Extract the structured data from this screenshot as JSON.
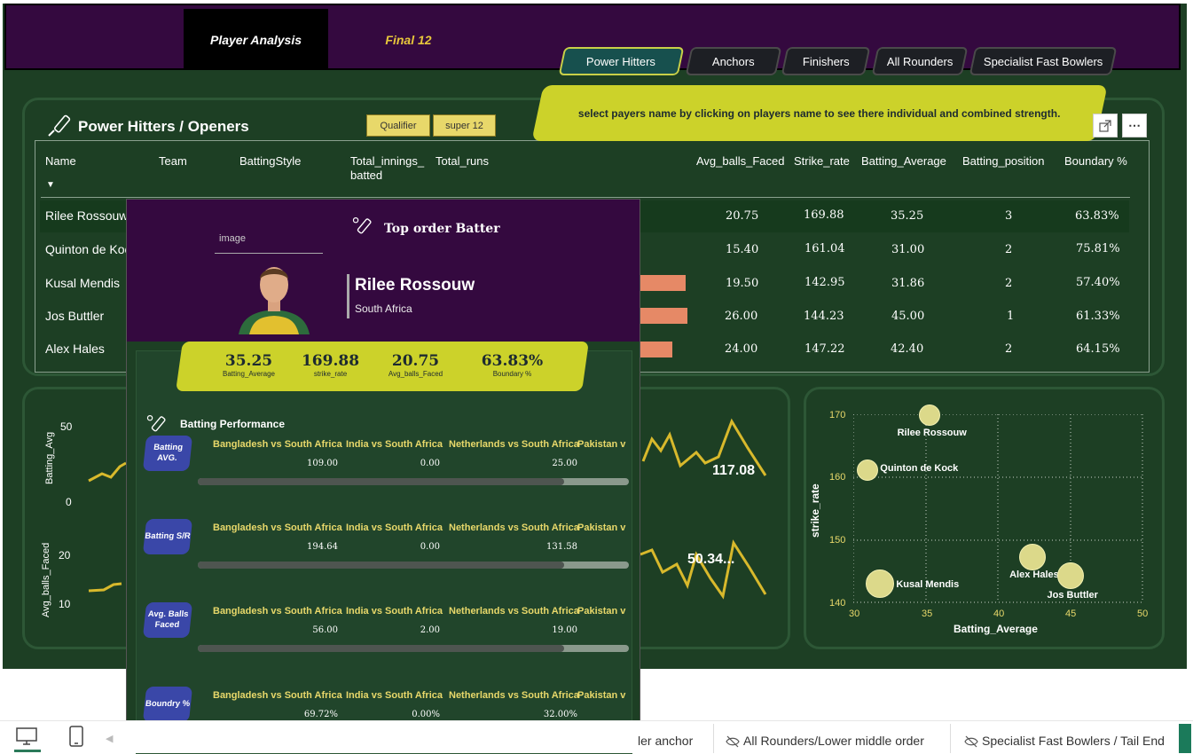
{
  "nav": {
    "active_tab": "Player Analysis",
    "other_tab": "Final 12"
  },
  "segments": [
    "Power Hitters",
    "Anchors",
    "Finishers",
    "All Rounders",
    "Specialist Fast Bowlers"
  ],
  "banner_text": "select payers name by clicking on players name to see there individual and combined strength.",
  "table": {
    "title": "Power Hitters / Openers",
    "chips": [
      "Qualifier",
      "super 12"
    ],
    "headers": {
      "name": "Name",
      "team": "Team",
      "style": "BattingStyle",
      "innings": "Total_innings_ batted",
      "runs": "Total_runs",
      "balls": "Avg_balls_Faced",
      "sr": "Strike_rate",
      "avg": "Batting_Average",
      "pos": "Batting_position",
      "boundary": "Boundary %"
    },
    "rows": [
      {
        "name": "Rilee Rossouw",
        "balls": "20.75",
        "sr": "169.88",
        "avg": "35.25",
        "pos": "3",
        "boundary": "63.83%"
      },
      {
        "name": "Quinton de Kock",
        "balls": "15.40",
        "sr": "161.04",
        "avg": "31.00",
        "pos": "2",
        "boundary": "75.81%"
      },
      {
        "name": "Kusal Mendis",
        "balls": "19.50",
        "sr": "142.95",
        "avg": "31.86",
        "pos": "2",
        "boundary": "57.40%"
      },
      {
        "name": "Jos Buttler",
        "balls": "26.00",
        "sr": "144.23",
        "avg": "45.00",
        "pos": "1",
        "boundary": "61.33%"
      },
      {
        "name": "Alex Hales",
        "balls": "24.00",
        "sr": "147.22",
        "avg": "42.40",
        "pos": "2",
        "boundary": "64.15%"
      }
    ]
  },
  "left_chart": {
    "ylabel_top": "Batting_Avg",
    "ylabel_bottom": "Avg_balls_Faced",
    "ticks_top": [
      "50",
      "0"
    ],
    "ticks_bottom": [
      "20",
      "10"
    ],
    "value_top": "117.08",
    "value_bottom": "50.34..."
  },
  "scatter": {
    "xlabel": "Batting_Average",
    "ylabel": "strike_rate",
    "x_ticks": [
      "30",
      "35",
      "40",
      "45",
      "50"
    ],
    "y_ticks": [
      "170",
      "160",
      "150",
      "140"
    ],
    "color": "#dcd98a"
  },
  "chart_data": {
    "type": "scatter",
    "xlabel": "Batting_Average",
    "ylabel": "strike_rate",
    "xlim": [
      30,
      50
    ],
    "ylim": [
      140,
      170
    ],
    "points": [
      {
        "label": "Rilee Rossouw",
        "x": 35.25,
        "y": 169.88
      },
      {
        "label": "Quinton de Kock",
        "x": 31.0,
        "y": 161.04
      },
      {
        "label": "Kusal Mendis",
        "x": 31.86,
        "y": 142.95
      },
      {
        "label": "Alex Hales",
        "x": 42.4,
        "y": 147.22
      },
      {
        "label": "Jos Buttler",
        "x": 45.0,
        "y": 144.23
      }
    ]
  },
  "tooltip": {
    "image_label": "image",
    "role": "Top order Batter",
    "player": "Rilee Rossouw",
    "country": "South Africa",
    "stats": [
      {
        "value": "35.25",
        "label": "Batting_Average"
      },
      {
        "value": "169.88",
        "label": "strike_rate"
      },
      {
        "value": "20.75",
        "label": "Avg_balls_Faced"
      },
      {
        "value": "63.83%",
        "label": "Boundary %"
      }
    ],
    "section_title": "Batting Performance",
    "matches": [
      "Bangladesh vs South Africa",
      "India vs South Africa",
      "Netherlands vs South Africa",
      "Pakistan v"
    ],
    "metrics": [
      {
        "label": "Batting AVG.",
        "values": [
          "109.00",
          "0.00",
          "25.00"
        ],
        "fill": 0.85
      },
      {
        "label": "Batting S/R",
        "values": [
          "194.64",
          "0.00",
          "131.58"
        ],
        "fill": 0.85
      },
      {
        "label": "Avg. Balls Faced",
        "values": [
          "56.00",
          "2.00",
          "19.00"
        ],
        "fill": 0.85
      },
      {
        "label": "Boundry %",
        "values": [
          "69.72%",
          "0.00%",
          "32.00%"
        ],
        "fill": 0.85
      }
    ]
  },
  "footer": {
    "tab1": "ler anchor",
    "tab2": "All Rounders/Lower middle order",
    "tab3": "Specialist Fast Bowlers / Tail End"
  }
}
